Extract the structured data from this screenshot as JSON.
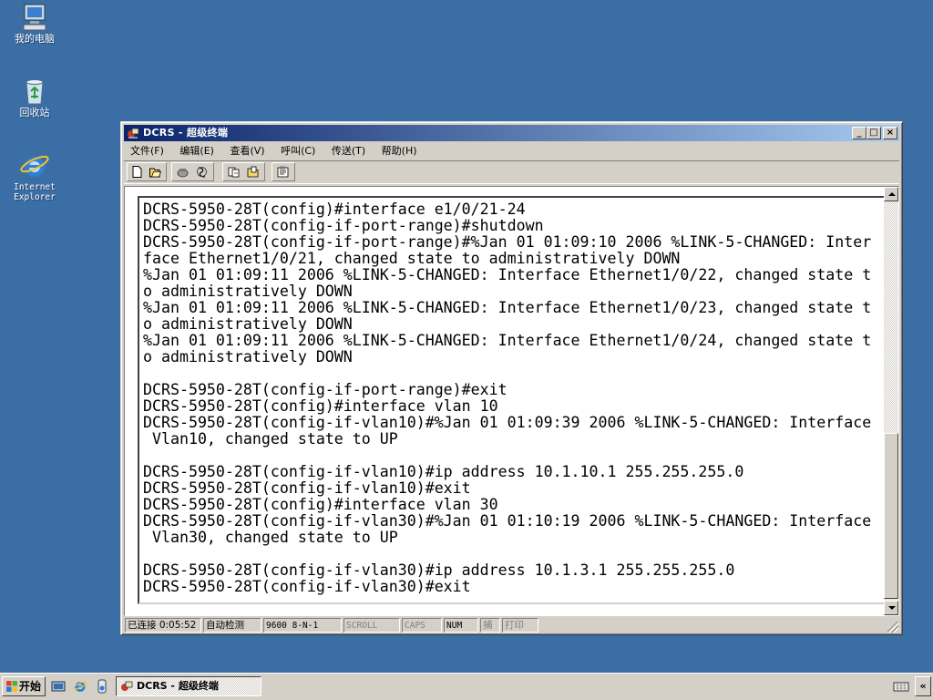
{
  "desktop": {
    "icons": [
      {
        "label": "我的电脑",
        "icon": "my-computer-icon"
      },
      {
        "label": "回收站",
        "icon": "recycle-bin-icon"
      },
      {
        "label": "Internet\nExplorer",
        "icon": "internet-explorer-icon"
      }
    ]
  },
  "window": {
    "title": "DCRS - 超级终端",
    "menu": [
      "文件(F)",
      "编辑(E)",
      "查看(V)",
      "呼叫(C)",
      "传送(T)",
      "帮助(H)"
    ],
    "controls": {
      "minimize": "_",
      "maximize": "□",
      "close": "×"
    },
    "toolbar_icons": [
      "new-icon",
      "open-icon",
      "call-icon",
      "disconnect-icon",
      "send-icon",
      "receive-icon",
      "properties-icon"
    ]
  },
  "terminal": {
    "lines": [
      "DCRS-5950-28T(config)#interface e1/0/21-24",
      "DCRS-5950-28T(config-if-port-range)#shutdown",
      "DCRS-5950-28T(config-if-port-range)#%Jan 01 01:09:10 2006 %LINK-5-CHANGED: Inter",
      "face Ethernet1/0/21, changed state to administratively DOWN",
      "%Jan 01 01:09:11 2006 %LINK-5-CHANGED: Interface Ethernet1/0/22, changed state t",
      "o administratively DOWN",
      "%Jan 01 01:09:11 2006 %LINK-5-CHANGED: Interface Ethernet1/0/23, changed state t",
      "o administratively DOWN",
      "%Jan 01 01:09:11 2006 %LINK-5-CHANGED: Interface Ethernet1/0/24, changed state t",
      "o administratively DOWN",
      "",
      "DCRS-5950-28T(config-if-port-range)#exit",
      "DCRS-5950-28T(config)#interface vlan 10",
      "DCRS-5950-28T(config-if-vlan10)#%Jan 01 01:09:39 2006 %LINK-5-CHANGED: Interface",
      " Vlan10, changed state to UP",
      "",
      "DCRS-5950-28T(config-if-vlan10)#ip address 10.1.10.1 255.255.255.0",
      "DCRS-5950-28T(config-if-vlan10)#exit",
      "DCRS-5950-28T(config)#interface vlan 30",
      "DCRS-5950-28T(config-if-vlan30)#%Jan 01 01:10:19 2006 %LINK-5-CHANGED: Interface",
      " Vlan30, changed state to UP",
      "",
      "DCRS-5950-28T(config-if-vlan30)#ip address 10.1.3.1 255.255.255.0",
      "DCRS-5950-28T(config-if-vlan30)#exit"
    ]
  },
  "statusbar": {
    "connected": "已连接 0:05:52",
    "detect": "自动检测",
    "settings": "9600 8-N-1",
    "scroll": "SCROLL",
    "caps": "CAPS",
    "num": "NUM",
    "capture": "捕",
    "print": "打印"
  },
  "taskbar": {
    "start_label": "开始",
    "quicklaunch": [
      "show-desktop-icon",
      "internet-explorer-icon",
      "media-icon"
    ],
    "task_label": "DCRS - 超级终端",
    "tray_icons": [
      "keyboard-icon"
    ],
    "expand_label": "«"
  },
  "colors": {
    "desktop": "#3a6ea5",
    "titlebar_start": "#0a246a",
    "titlebar_end": "#a6caf0",
    "chrome": "#d4d0c8"
  }
}
